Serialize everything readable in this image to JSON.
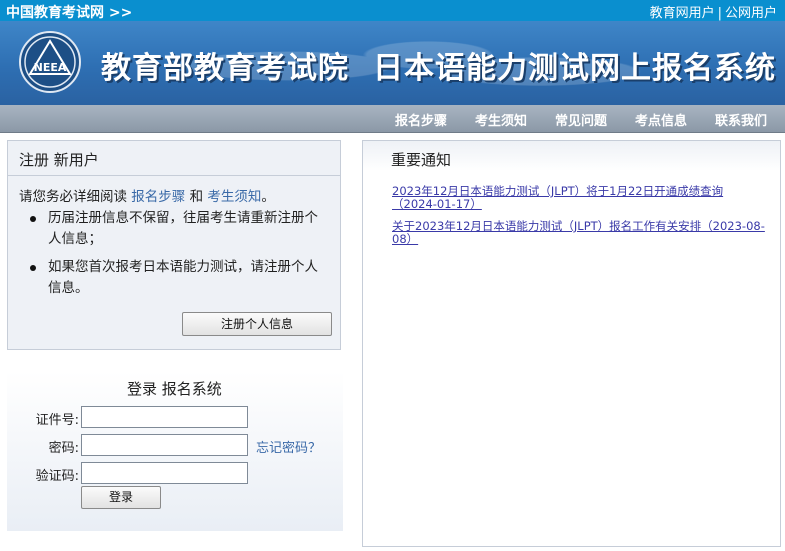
{
  "topbar": {
    "site_name": "中国教育考试网 >>",
    "links": [
      "教育网用户",
      "公网用户"
    ],
    "separator": "|"
  },
  "banner": {
    "logo_text": "NEEA",
    "org": "教育部教育考试院",
    "system": "日本语能力测试网上报名系统"
  },
  "nav": {
    "items": [
      "报名步骤",
      "考生须知",
      "常见问题",
      "考点信息",
      "联系我们"
    ]
  },
  "register": {
    "title": "注册 新用户",
    "intro_prefix": "请您务必详细阅读 ",
    "link_steps": "报名步骤",
    "intro_and": " 和 ",
    "link_notice": "考生须知",
    "intro_suffix": "。",
    "bullets": [
      "历届注册信息不保留，往届考生请重新注册个人信息；",
      "如果您首次报考日本语能力测试，请注册个人信息。"
    ],
    "button": "注册个人信息"
  },
  "login": {
    "title": "登录 报名系统",
    "id_label": "证件号:",
    "password_label": "密码:",
    "captcha_label": "验证码:",
    "forgot": "忘记密码？",
    "button": "登录",
    "id_value": "",
    "password_value": "",
    "captcha_value": ""
  },
  "notices": {
    "title": "重要通知",
    "items": [
      "2023年12月日本语能力测试（JLPT）将于1月22日开通成绩查询（2024-01-17）",
      "关于2023年12月日本语能力测试（JLPT）报名工作有关安排（2023-08-08）"
    ]
  },
  "colors": {
    "topbar": "#0a8fcf",
    "banner": "#2e6fb3",
    "navbar": "#8b98a7",
    "link": "#3a6aa8"
  }
}
